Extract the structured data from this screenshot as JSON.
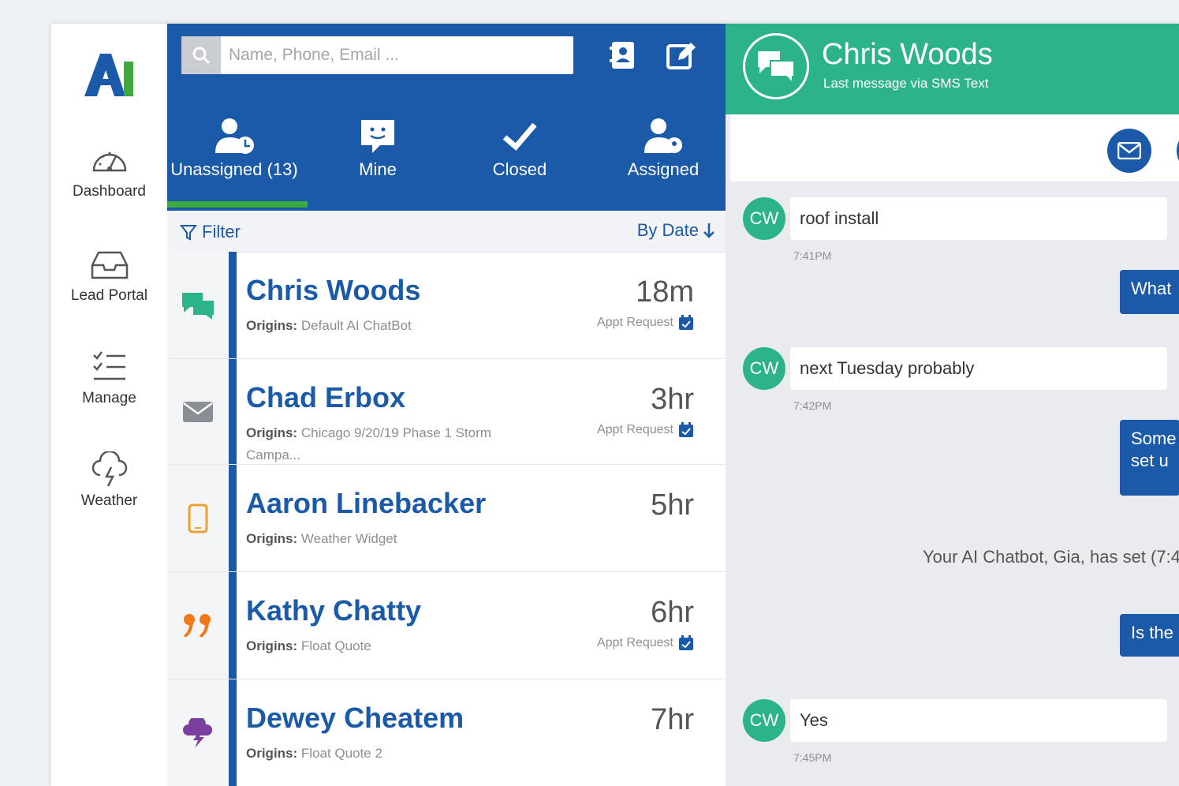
{
  "nav": {
    "items": [
      {
        "label": "Dashboard",
        "icon": "speedometer-icon"
      },
      {
        "label": "Lead Portal",
        "icon": "inbox-icon"
      },
      {
        "label": "Manage",
        "icon": "checklist-icon"
      },
      {
        "label": "Weather",
        "icon": "storm-cloud-icon"
      }
    ]
  },
  "search": {
    "placeholder": "Name, Phone, Email ..."
  },
  "tabs": [
    {
      "label": "Unassigned (13)",
      "icon": "user-clock-icon"
    },
    {
      "label": "Mine",
      "icon": "chat-user-icon"
    },
    {
      "label": "Closed",
      "icon": "check-icon"
    },
    {
      "label": "Assigned",
      "icon": "user-assigned-icon"
    }
  ],
  "filter": {
    "label": "Filter",
    "sort_label": "By Date"
  },
  "leads": [
    {
      "name": "Chris Woods",
      "origin_label": "Origins:",
      "origin": "Default AI ChatBot",
      "time": "18m",
      "appt": "Appt Request",
      "channel": "chat-icon",
      "channel_color": "#2db38a"
    },
    {
      "name": "Chad Erbox",
      "origin_label": "Origins:",
      "origin": "Chicago 9/20/19 Phase 1 Storm Campa...",
      "time": "3hr",
      "appt": "Appt Request",
      "channel": "envelope-icon",
      "channel_color": "#8a8f95"
    },
    {
      "name": "Aaron Linebacker",
      "origin_label": "Origins:",
      "origin": "Weather Widget",
      "time": "5hr",
      "appt": "",
      "channel": "phone-icon",
      "channel_color": "#f0a030"
    },
    {
      "name": "Kathy Chatty",
      "origin_label": "Origins:",
      "origin": "Float Quote",
      "time": "6hr",
      "appt": "Appt Request",
      "channel": "quote-icon",
      "channel_color": "#f07a1a"
    },
    {
      "name": "Dewey Cheatem",
      "origin_label": "Origins:",
      "origin": "Float Quote 2",
      "time": "7hr",
      "appt": "",
      "channel": "storm-icon",
      "channel_color": "#7b3fa0"
    }
  ],
  "chat": {
    "name": "Chris Woods",
    "subtitle": "Last message via SMS Text",
    "messages_in": [
      {
        "initials": "CW",
        "text": "roof install",
        "time": "7:41PM"
      },
      {
        "initials": "CW",
        "text": "next Tuesday probably",
        "time": "7:42PM"
      },
      {
        "initials": "CW",
        "text": "Yes",
        "time": "7:45PM"
      }
    ],
    "messages_out": [
      "What",
      "Some set u",
      "Is the"
    ],
    "system": "Your AI Chatbot, Gia, has set (7:4"
  },
  "colors": {
    "primary": "#1a5aa8",
    "accent_green": "#2db38a",
    "tab_indicator": "#3daa3d"
  }
}
